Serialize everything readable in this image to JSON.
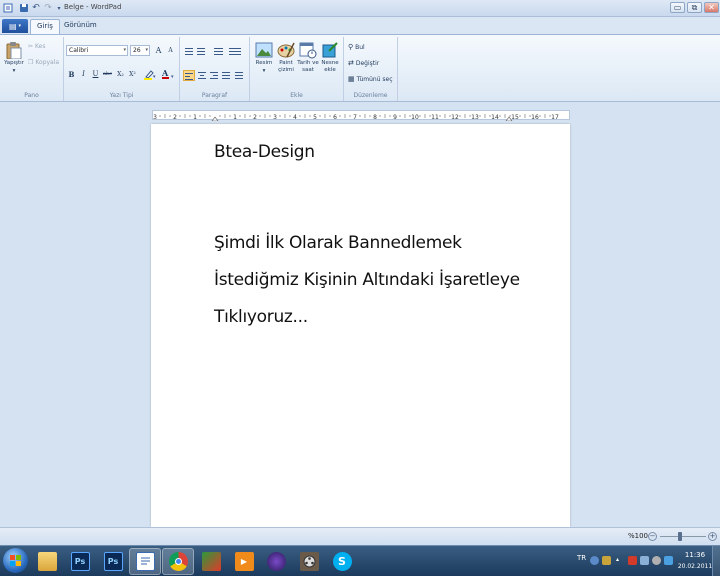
{
  "window": {
    "title": "Belge - WordPad",
    "minimize": "▭",
    "maximize": "⧉",
    "close": "✕"
  },
  "tabs": {
    "app_menu": "▤",
    "home": "Giriş",
    "view": "Görünüm"
  },
  "ribbon": {
    "clipboard": {
      "label": "Pano",
      "paste": "Yapıştır",
      "cut": "Kes",
      "copy": "Kopyala"
    },
    "font": {
      "label": "Yazı Tipi",
      "family": "Calibri",
      "size": "26",
      "bold": "B",
      "italic": "I",
      "underline": "U",
      "strike": "abc",
      "subscript": "X₂",
      "superscript": "X²",
      "grow": "A",
      "shrink": "A"
    },
    "paragraph": {
      "label": "Paragraf"
    },
    "insert": {
      "label": "Ekle",
      "picture": "Resim",
      "paint": "Paint çizimi",
      "datetime": "Tarih ve saat",
      "object": "Nesne ekle"
    },
    "editing": {
      "label": "Düzenleme",
      "find": "Bul",
      "replace": "Değiştir",
      "select_all": "Tümünü seç"
    }
  },
  "ruler": {
    "labels": [
      "3",
      "2",
      "1",
      "",
      "1",
      "2",
      "3",
      "4",
      "5",
      "6",
      "7",
      "8",
      "9",
      "10",
      "11",
      "12",
      "13",
      "14",
      "15",
      "16",
      "17"
    ]
  },
  "document": {
    "lines": [
      "Btea-Design",
      "Şimdi İlk Olarak Bannedlemek",
      "İstediğmiz Kişinin Altındaki İşaretleye",
      "Tıklıyoruz..."
    ]
  },
  "statusbar": {
    "zoom": "%100",
    "zoom_out": "−",
    "zoom_in": "+"
  },
  "taskbar": {
    "photoshop_1": "Ps",
    "photoshop_2": "Ps",
    "lang": "TR",
    "time": "11:36",
    "date": "20.02.2011"
  },
  "colors": {
    "accent": "#1e4f9c",
    "ribbon_bg": "#dce8f5",
    "canvas_bg": "#d5e2f2",
    "taskbar": "#1c3a5c"
  }
}
